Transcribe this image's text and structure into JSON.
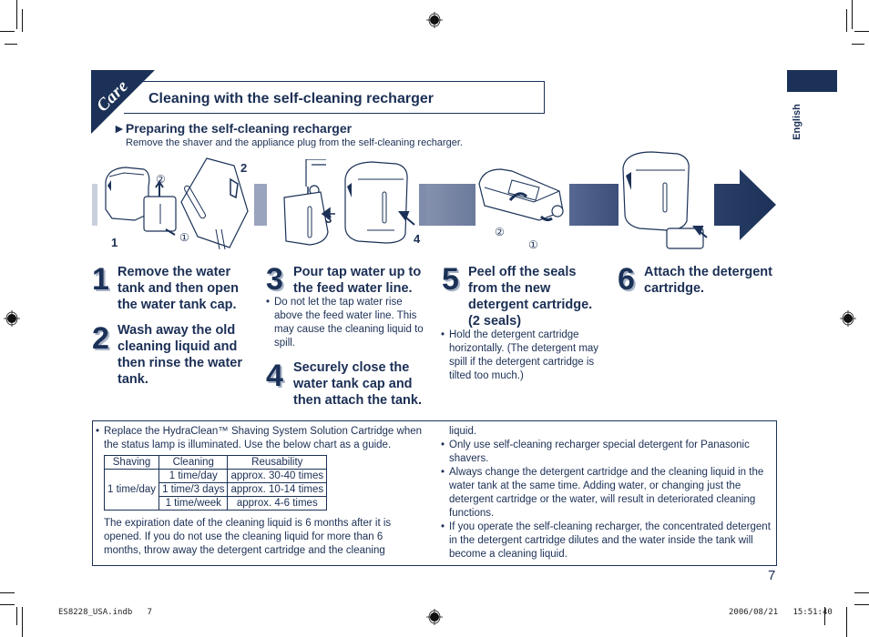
{
  "header": {
    "section_tab": "Care",
    "title": "Cleaning with the self-cleaning recharger",
    "language_tab": "English",
    "subsection_title": "Preparing the self-cleaning recharger",
    "subsection_arrow": "►",
    "subsection_desc": "Remove the shaver and the appliance plug from the self-cleaning recharger."
  },
  "illustrations": {
    "labels": [
      "1",
      "2",
      "3",
      "4"
    ],
    "circled": {
      "one": "①",
      "two": "②"
    },
    "band_colors": [
      "#c9cfdc",
      "#9aa4bd",
      "#7f8cab",
      "#5a6b8e",
      "#3f5279",
      "#1b3157"
    ]
  },
  "steps": [
    {
      "number": "1",
      "text": "Remove the water tank and then open the water tank cap."
    },
    {
      "number": "2",
      "text": "Wash away the old cleaning liquid and then rinse the water tank."
    },
    {
      "number": "3",
      "text": "Pour tap water up to the feed water line.",
      "note": "Do not let the tap water rise above the feed water line. This may cause the cleaning liquid to spill."
    },
    {
      "number": "4",
      "text": "Securely close the water tank cap and then attach the tank."
    },
    {
      "number": "5",
      "text": "Peel off the seals from the new detergent cartridge. (2 seals)",
      "note": "Hold the detergent cartridge horizontally. (The detergent may spill if the detergent cartridge is tilted too much.)"
    },
    {
      "number": "6",
      "text": "Attach the detergent cartridge."
    }
  ],
  "info": {
    "bullet_intro": "Replace the HydraClean™ Shaving System Solution Cartridge when the status lamp is illuminated. Use the below chart as a guide.",
    "table": {
      "headers": [
        "Shaving",
        "Cleaning",
        "Reusability"
      ],
      "shaving": "1 time/day",
      "rows": [
        {
          "cleaning": "1 time/day",
          "reusability": "approx. 30-40 times"
        },
        {
          "cleaning": "1 time/3 days",
          "reusability": "approx. 10-14 times"
        },
        {
          "cleaning": "1 time/week",
          "reusability": "approx. 4-6 times"
        }
      ]
    },
    "expiration": "The expiration date of the cleaning liquid is 6 months after it is opened. If you do not use the cleaning liquid for more than 6 months, throw away the detergent cartridge and the cleaning liquid.",
    "expiration_part1": "The expiration date of the cleaning liquid is 6 months after it is opened. If you do not use the cleaning liquid for more than 6 months, throw away the detergent cartridge and the cleaning",
    "expiration_part2": "liquid.",
    "bullets": [
      "Only use self-cleaning recharger special detergent for Panasonic shavers.",
      "Always change the detergent cartridge and the cleaning liquid in the water tank at the same time. Adding water, or changing just the detergent cartridge or the water, will result in deteriorated cleaning functions.",
      "If you operate the self-cleaning recharger, the concentrated detergent in the detergent cartridge dilutes and the water inside the tank will become a cleaning liquid."
    ]
  },
  "footer": {
    "page_number": "7",
    "file_slug": "ES8228_USA.indb   7",
    "timestamp": "2006/08/21   15:51:40"
  }
}
